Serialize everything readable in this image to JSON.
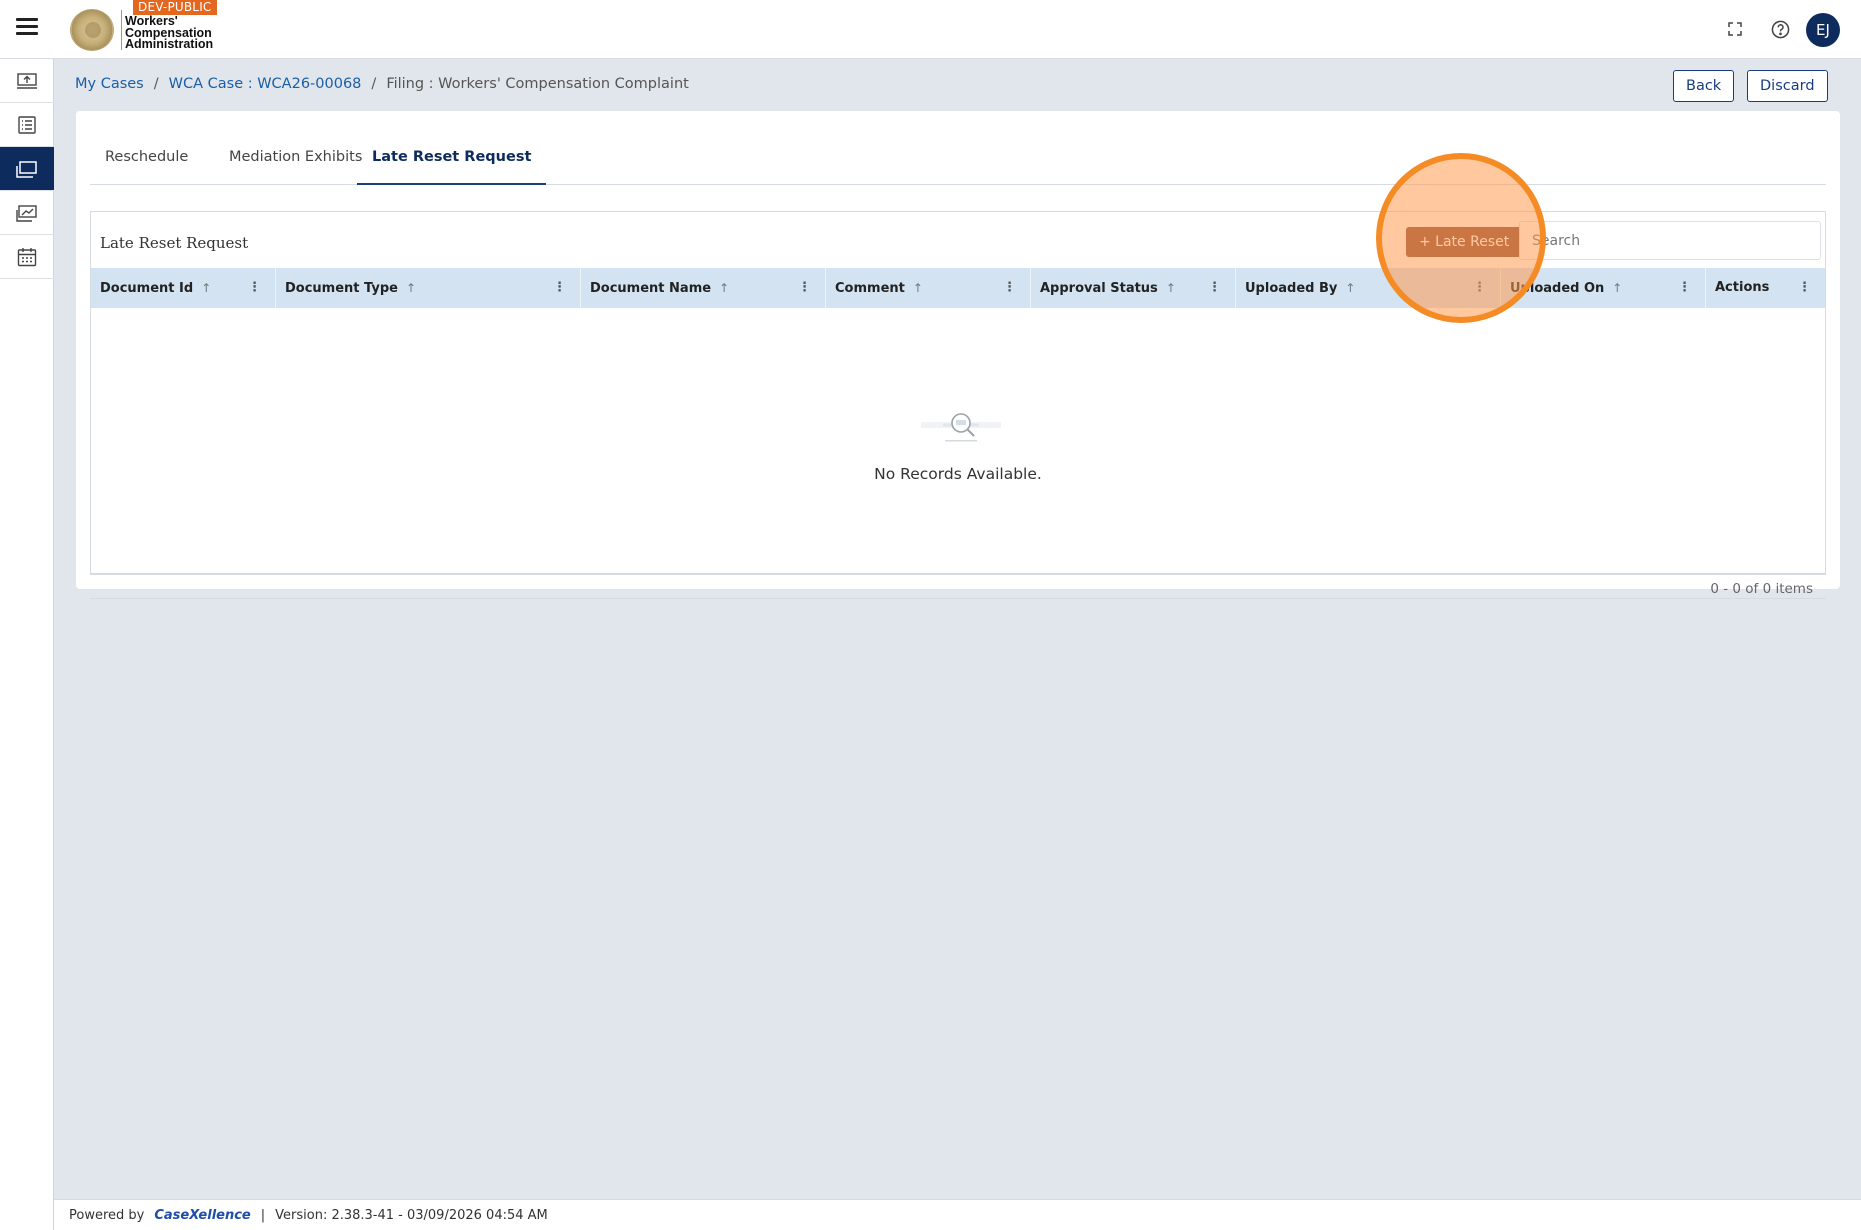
{
  "header": {
    "env_badge": "DEV-PUBLIC",
    "logo_text_line1": "Workers'",
    "logo_text_line2": "Compensation",
    "logo_text_line3": "Administration",
    "user_initials": "EJ"
  },
  "breadcrumb": {
    "items": [
      {
        "label": "My Cases"
      },
      {
        "label": "WCA Case : WCA26-00068"
      },
      {
        "label": "Filing : Workers' Compensation Complaint"
      }
    ]
  },
  "actions": {
    "back_label": "Back",
    "discard_label": "Discard"
  },
  "tabs": [
    {
      "label": "Reschedule",
      "active": false
    },
    {
      "label": "Mediation Exhibits",
      "active": false
    },
    {
      "label": "Late Reset Request",
      "active": true
    }
  ],
  "grid": {
    "title": "Late Reset Request",
    "add_button_label": "+ Late Reset",
    "search_placeholder": "Search",
    "columns": [
      {
        "label": "Document Id"
      },
      {
        "label": "Document Type"
      },
      {
        "label": "Document Name"
      },
      {
        "label": "Comment"
      },
      {
        "label": "Approval Status"
      },
      {
        "label": "Uploaded By"
      },
      {
        "label": "Uploaded On"
      },
      {
        "label": "Actions"
      }
    ],
    "empty_message": "No Records Available.",
    "pager_text": "0 - 0 of 0 items"
  },
  "footer": {
    "powered_by": "Powered by",
    "brand": "CaseXellence",
    "separator": "|",
    "version": "Version: 2.38.3-41 - 03/09/2026 04:54 AM"
  },
  "colors": {
    "primary": "#0d2b5c",
    "add_button": "#8a4a35",
    "highlight_ring": "#f58b25",
    "env_badge": "#e4671f"
  },
  "icons": {
    "menu": "hamburger-icon",
    "fullscreen": "fullscreen-icon",
    "help": "help-icon",
    "nav": [
      "upload-icon",
      "list-icon",
      "briefcase-icon",
      "dashboard-icon",
      "calendar-icon"
    ]
  }
}
